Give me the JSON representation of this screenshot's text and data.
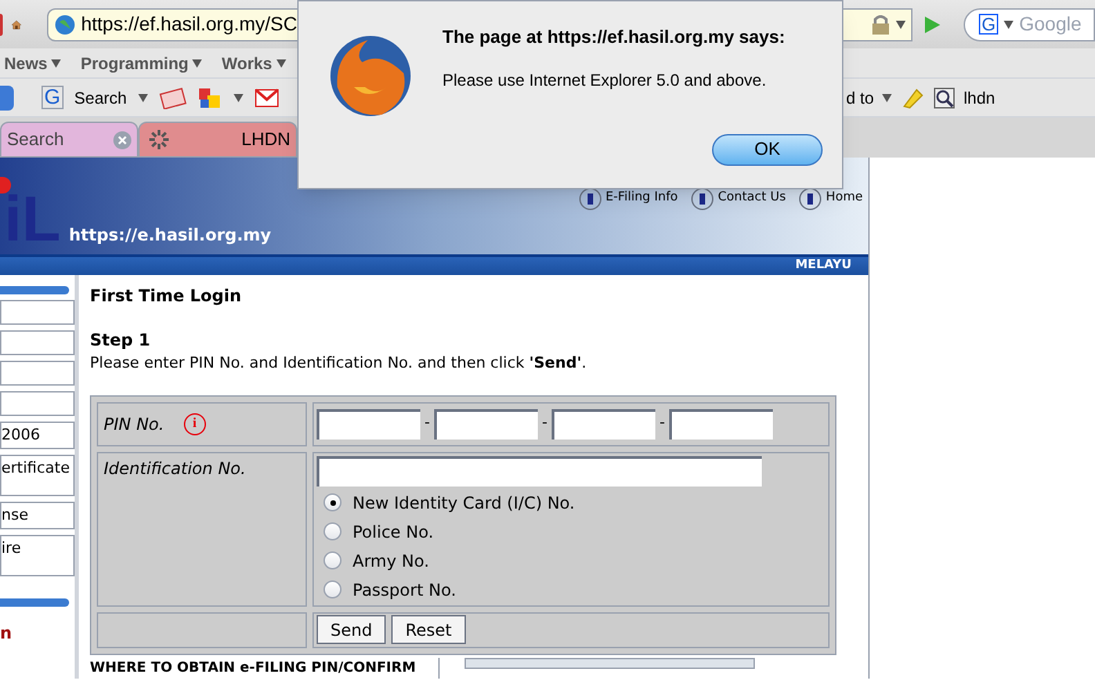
{
  "browser": {
    "url": "https://ef.hasil.org.my/SC",
    "search_placeholder": "Google",
    "bookmarks": [
      "News",
      "Programming",
      "Works"
    ],
    "engine_mark": "G",
    "toolbar": {
      "engine_mark": "G",
      "search_label": "Search",
      "cut_label": "d to",
      "query": "lhdn"
    },
    "tabs": [
      {
        "label": "Search",
        "color": "#e2b6dc",
        "closable": true,
        "loading": false
      },
      {
        "label": "LHDN",
        "color": "#e08c8e",
        "closable": false,
        "loading": true
      }
    ]
  },
  "dialog": {
    "title": "The page at https://ef.hasil.org.my says:",
    "message": "Please use Internet Explorer 5.0 and above.",
    "button": "OK"
  },
  "site": {
    "logo_text": "iL",
    "url": "https://e.hasil.org.my",
    "links": [
      "E-Filing Info",
      "Contact Us",
      "Home"
    ],
    "language": "MELAYU"
  },
  "sidebar": {
    "items": [
      "2006",
      "ertificate",
      "nse",
      "ire"
    ],
    "section": "n"
  },
  "form": {
    "title": "First Time Login",
    "step": "Step 1",
    "instruction": "Please enter PIN No. and Identification No. and then click **'Send'**.",
    "pin_label": "PIN No.",
    "info_mark": "i",
    "separators": [
      "-",
      "-",
      "-"
    ],
    "id_label": "Identification No.",
    "id_types": [
      {
        "label": "New Identity Card (I/C) No.",
        "selected": true
      },
      {
        "label": "Police No.",
        "selected": false
      },
      {
        "label": "Army No.",
        "selected": false
      },
      {
        "label": "Passport No.",
        "selected": false
      }
    ],
    "buttons": [
      "Send",
      "Reset"
    ]
  },
  "footer_heading": "WHERE TO OBTAIN e-FILING PIN/CONFIRM"
}
